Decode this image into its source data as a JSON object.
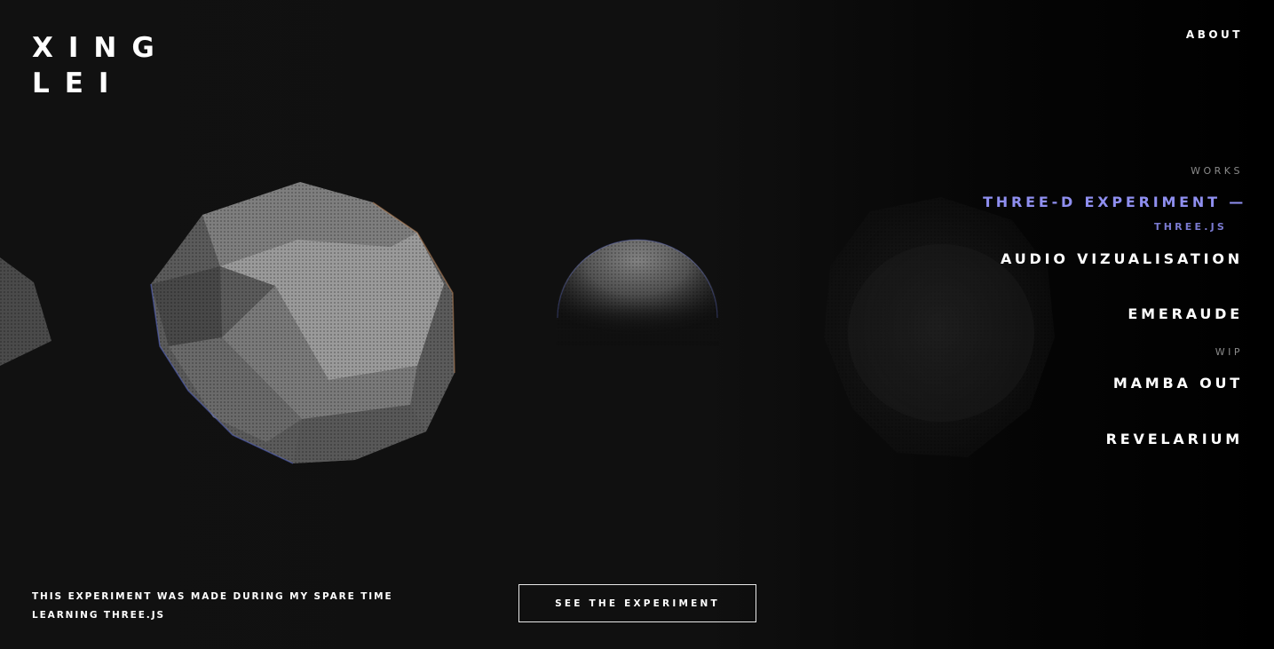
{
  "brand": {
    "line1": "XING",
    "line2": "LEI"
  },
  "header": {
    "about_label": "ABOUT"
  },
  "works": {
    "section_label": "WORKS",
    "items": [
      {
        "label": "THREE-D EXPERIMENT —",
        "sub": "THREE.JS",
        "active": true
      },
      {
        "label": "AUDIO VIZUALISATION"
      },
      {
        "label": "EMERAUDE"
      }
    ],
    "wip_label": "WIP",
    "wip_items": [
      {
        "label": "MAMBA OUT"
      },
      {
        "label": "REVELARIUM"
      }
    ]
  },
  "footer": {
    "description_line1": "THIS EXPERIMENT WAS MADE DURING MY SPARE TIME",
    "description_line2": "LEARNING THREE.JS",
    "cta_label": "SEE THE EXPERIMENT"
  },
  "colors": {
    "background": "#0f0f0f",
    "text": "#ffffff",
    "accent": "#8f8ff0",
    "accent_sub": "#7a7ad0",
    "muted": "#8a8a8a"
  }
}
